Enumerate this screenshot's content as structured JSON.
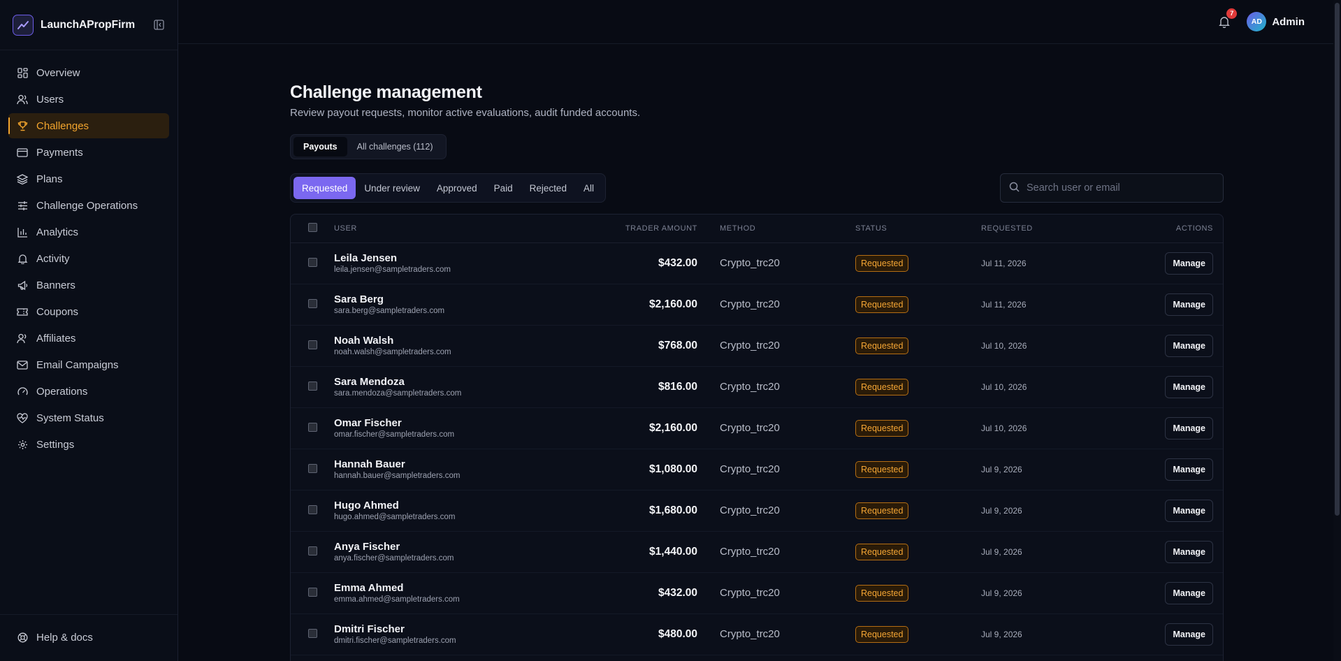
{
  "brand": {
    "name": "LaunchAPropFirm",
    "logo_icon": "trending-chart-icon"
  },
  "sidebar": {
    "items": [
      {
        "label": "Overview",
        "icon": "grid-icon",
        "active": false
      },
      {
        "label": "Users",
        "icon": "users-icon",
        "active": false
      },
      {
        "label": "Challenges",
        "icon": "trophy-icon",
        "active": true
      },
      {
        "label": "Payments",
        "icon": "credit-card-icon",
        "active": false
      },
      {
        "label": "Plans",
        "icon": "layers-icon",
        "active": false
      },
      {
        "label": "Challenge Operations",
        "icon": "sliders-icon",
        "active": false
      },
      {
        "label": "Analytics",
        "icon": "bar-chart-icon",
        "active": false
      },
      {
        "label": "Activity",
        "icon": "bell-icon",
        "active": false
      },
      {
        "label": "Banners",
        "icon": "megaphone-icon",
        "active": false
      },
      {
        "label": "Coupons",
        "icon": "ticket-icon",
        "active": false
      },
      {
        "label": "Affiliates",
        "icon": "user-icon",
        "active": false
      },
      {
        "label": "Email Campaigns",
        "icon": "mail-icon",
        "active": false
      },
      {
        "label": "Operations",
        "icon": "gauge-icon",
        "active": false
      },
      {
        "label": "System Status",
        "icon": "heart-pulse-icon",
        "active": false
      },
      {
        "label": "Settings",
        "icon": "gear-icon",
        "active": false
      }
    ],
    "footer_label": "Help & docs"
  },
  "header": {
    "notification_count": "7",
    "avatar_initials": "AD",
    "user_name": "Admin"
  },
  "page": {
    "title": "Challenge management",
    "subtitle": "Review payout requests, monitor active evaluations, audit funded accounts."
  },
  "tabs": [
    {
      "label": "Payouts",
      "active": true
    },
    {
      "label": "All challenges (112)",
      "active": false
    }
  ],
  "filters": [
    {
      "label": "Requested",
      "active": true
    },
    {
      "label": "Under review",
      "active": false
    },
    {
      "label": "Approved",
      "active": false
    },
    {
      "label": "Paid",
      "active": false
    },
    {
      "label": "Rejected",
      "active": false
    },
    {
      "label": "All",
      "active": false
    }
  ],
  "search": {
    "placeholder": "Search user or email",
    "value": ""
  },
  "table": {
    "columns": {
      "user": "USER",
      "amount": "TRADER AMOUNT",
      "method": "METHOD",
      "status": "STATUS",
      "requested": "REQUESTED",
      "actions": "ACTIONS"
    },
    "rows": [
      {
        "name": "Leila Jensen",
        "email": "leila.jensen@sampletraders.com",
        "amount": "$432.00",
        "method": "Crypto_trc20",
        "status": "Requested",
        "requested": "Jul 11, 2026",
        "action": "Manage"
      },
      {
        "name": "Sara Berg",
        "email": "sara.berg@sampletraders.com",
        "amount": "$2,160.00",
        "method": "Crypto_trc20",
        "status": "Requested",
        "requested": "Jul 11, 2026",
        "action": "Manage"
      },
      {
        "name": "Noah Walsh",
        "email": "noah.walsh@sampletraders.com",
        "amount": "$768.00",
        "method": "Crypto_trc20",
        "status": "Requested",
        "requested": "Jul 10, 2026",
        "action": "Manage"
      },
      {
        "name": "Sara Mendoza",
        "email": "sara.mendoza@sampletraders.com",
        "amount": "$816.00",
        "method": "Crypto_trc20",
        "status": "Requested",
        "requested": "Jul 10, 2026",
        "action": "Manage"
      },
      {
        "name": "Omar Fischer",
        "email": "omar.fischer@sampletraders.com",
        "amount": "$2,160.00",
        "method": "Crypto_trc20",
        "status": "Requested",
        "requested": "Jul 10, 2026",
        "action": "Manage"
      },
      {
        "name": "Hannah Bauer",
        "email": "hannah.bauer@sampletraders.com",
        "amount": "$1,080.00",
        "method": "Crypto_trc20",
        "status": "Requested",
        "requested": "Jul 9, 2026",
        "action": "Manage"
      },
      {
        "name": "Hugo Ahmed",
        "email": "hugo.ahmed@sampletraders.com",
        "amount": "$1,680.00",
        "method": "Crypto_trc20",
        "status": "Requested",
        "requested": "Jul 9, 2026",
        "action": "Manage"
      },
      {
        "name": "Anya Fischer",
        "email": "anya.fischer@sampletraders.com",
        "amount": "$1,440.00",
        "method": "Crypto_trc20",
        "status": "Requested",
        "requested": "Jul 9, 2026",
        "action": "Manage"
      },
      {
        "name": "Emma Ahmed",
        "email": "emma.ahmed@sampletraders.com",
        "amount": "$432.00",
        "method": "Crypto_trc20",
        "status": "Requested",
        "requested": "Jul 9, 2026",
        "action": "Manage"
      },
      {
        "name": "Dmitri Fischer",
        "email": "dmitri.fischer@sampletraders.com",
        "amount": "$480.00",
        "method": "Crypto_trc20",
        "status": "Requested",
        "requested": "Jul 9, 2026",
        "action": "Manage"
      }
    ]
  },
  "colors": {
    "accent": "#7b68f0",
    "active_nav": "#f3a52d",
    "status_requested": "#f4a534",
    "background": "#080b14",
    "badge": "#e03a3a"
  }
}
